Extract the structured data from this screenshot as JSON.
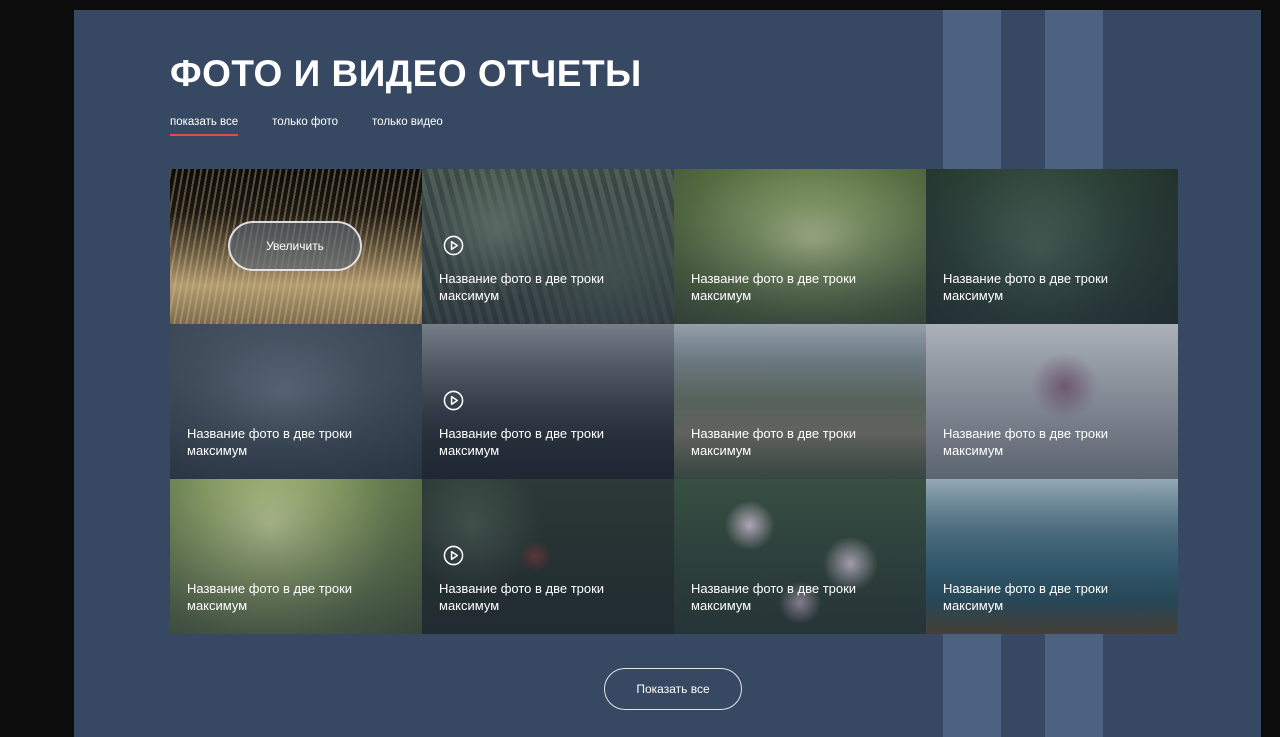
{
  "page": {
    "title": "ФОТО И ВИДЕО ОТЧЕТЫ",
    "accent_color": "#e04a54",
    "background_color": "#364862"
  },
  "filters": [
    {
      "label": "показать все",
      "active": true
    },
    {
      "label": "только фото",
      "active": false
    },
    {
      "label": "только видео",
      "active": false
    }
  ],
  "gallery": {
    "zoom_label": "Увеличить",
    "items": [
      {
        "caption": "",
        "video": false,
        "hovered": true
      },
      {
        "caption": "Название фото в две троки максимум",
        "video": true
      },
      {
        "caption": "Название фото в две троки максимум",
        "video": false
      },
      {
        "caption": "Название фото в две троки максимум",
        "video": false
      },
      {
        "caption": "Название фото в две троки максимум",
        "video": false
      },
      {
        "caption": "Название фото в две троки максимум",
        "video": true
      },
      {
        "caption": "Название фото в две троки максимум",
        "video": false
      },
      {
        "caption": "Название фото в две троки максимум",
        "video": false
      },
      {
        "caption": "Название фото в две троки максимум",
        "video": false
      },
      {
        "caption": "Название фото в две троки максимум",
        "video": true
      },
      {
        "caption": "Название фото в две троки максимум",
        "video": false
      },
      {
        "caption": "Название фото в две троки максимум",
        "video": false
      }
    ]
  },
  "show_all_button": {
    "label": "Показать все"
  },
  "icons": {
    "play": "play-circle-icon"
  }
}
